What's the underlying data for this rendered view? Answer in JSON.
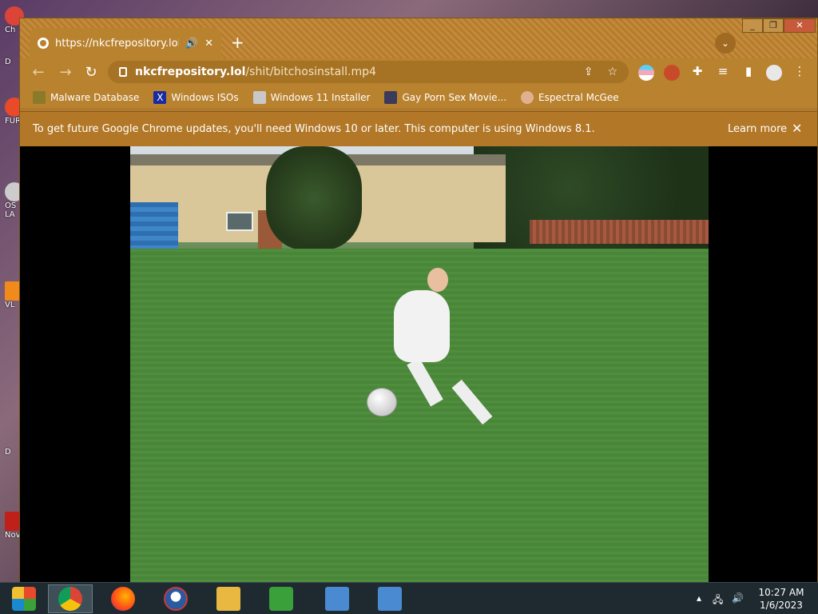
{
  "desktop": {
    "labels": [
      "Ch",
      "D",
      "FUR",
      "OS",
      "LA",
      "VL",
      "D",
      "Nov"
    ]
  },
  "browser": {
    "tab": {
      "title": "https://nkcfrepository.lol/sh"
    },
    "omnibox": {
      "host": "nkcfrepository.lol",
      "path": "/shit/bitchosinstall.mp4"
    },
    "bookmarks": [
      {
        "label": "Malware Database",
        "icon": "malware-icon",
        "color": "#8a7a2a"
      },
      {
        "label": "Windows ISOs",
        "icon": "x-icon",
        "color": "#1a2aa0"
      },
      {
        "label": "Windows 11 Installer",
        "icon": "installer-icon",
        "color": "#c8c8c8"
      },
      {
        "label": "Gay Porn Sex Movie...",
        "icon": "badge-icon",
        "color": "#3a3a5a"
      },
      {
        "label": "Espectral McGee",
        "icon": "avatar-icon",
        "color": "#e0b090"
      }
    ],
    "infobar": {
      "message": "To get future Google Chrome updates, you'll need Windows 10 or later. This computer is using Windows 8.1.",
      "learn_more": "Learn more"
    },
    "video": {
      "description_none": ""
    }
  },
  "taskbar": {
    "items": [
      {
        "name": "start-button",
        "color": "#1a8ad0"
      },
      {
        "name": "chrome-taskbar",
        "color": "#db4437"
      },
      {
        "name": "firefox-taskbar",
        "color": "#ff7a1a"
      },
      {
        "name": "obama-taskbar",
        "color": "#2a5aa0"
      },
      {
        "name": "explorer-taskbar",
        "color": "#e8b840"
      },
      {
        "name": "network-taskbar",
        "color": "#3aa03a"
      },
      {
        "name": "remote-taskbar-1",
        "color": "#4a8ad0"
      },
      {
        "name": "remote-taskbar-2",
        "color": "#4a8ad0"
      }
    ],
    "clock": {
      "time": "10:27 AM",
      "date": "1/6/2023"
    }
  }
}
